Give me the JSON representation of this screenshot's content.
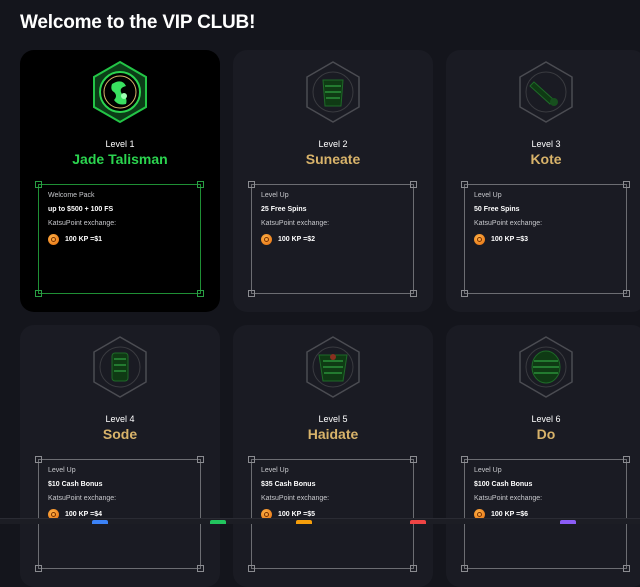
{
  "page": {
    "title": "Welcome to the VIP CLUB!"
  },
  "levels": [
    {
      "level": "Level 1",
      "name": "Jade Talisman",
      "benefit_label": "Welcome Pack",
      "benefit_value": "up to $500 + 100 FS",
      "exchange_label": "KatsuPoint exchange:",
      "rate": "100 KP =$1",
      "active": true
    },
    {
      "level": "Level 2",
      "name": "Suneate",
      "benefit_label": "Level Up",
      "benefit_value": "25 Free Spins",
      "exchange_label": "KatsuPoint exchange:",
      "rate": "100 KP =$2",
      "active": false
    },
    {
      "level": "Level 3",
      "name": "Kote",
      "benefit_label": "Level Up",
      "benefit_value": "50 Free Spins",
      "exchange_label": "KatsuPoint exchange:",
      "rate": "100 KP =$3",
      "active": false
    },
    {
      "level": "Level 4",
      "name": "Sode",
      "benefit_label": "Level Up",
      "benefit_value": "$10 Cash Bonus",
      "exchange_label": "KatsuPoint exchange:",
      "rate": "100 KP =$4",
      "active": false
    },
    {
      "level": "Level 5",
      "name": "Haidate",
      "benefit_label": "Level Up",
      "benefit_value": "$35 Cash Bonus",
      "exchange_label": "KatsuPoint exchange:",
      "rate": "100 KP =$5",
      "active": false
    },
    {
      "level": "Level 6",
      "name": "Do",
      "benefit_label": "Level Up",
      "benefit_value": "$100 Cash Bonus",
      "exchange_label": "KatsuPoint exchange:",
      "rate": "100 KP =$6",
      "active": false
    }
  ],
  "colors": {
    "accent_active": "#2bd44f",
    "accent_locked": "#d8b36a",
    "background": "#14151c"
  },
  "icons": [
    "jade-talisman-emblem-icon",
    "suneate-emblem-icon",
    "kote-emblem-icon",
    "sode-emblem-icon",
    "haidate-emblem-icon",
    "do-emblem-icon",
    "katsupoint-coin-icon"
  ]
}
